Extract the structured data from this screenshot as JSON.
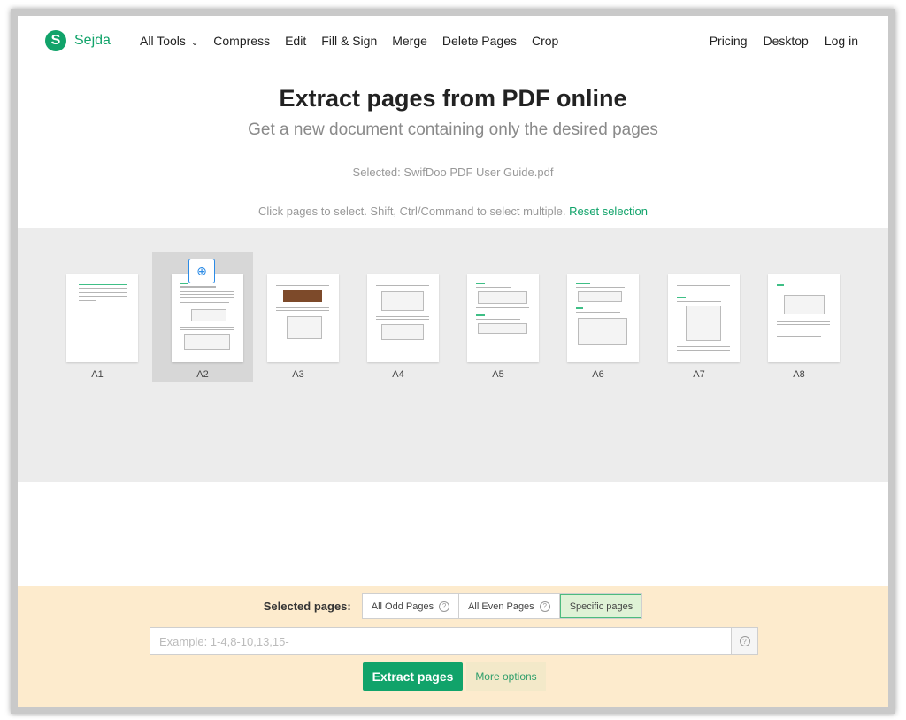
{
  "brand": {
    "name": "Sejda",
    "logo_letter": "S",
    "color": "#11a36a"
  },
  "nav": {
    "links": [
      "All Tools",
      "Compress",
      "Edit",
      "Fill & Sign",
      "Merge",
      "Delete Pages",
      "Crop"
    ],
    "right": [
      "Pricing",
      "Desktop",
      "Log in"
    ]
  },
  "header": {
    "title": "Extract pages from PDF online",
    "subtitle": "Get a new document containing only the desired pages",
    "selected_file": "Selected: SwifDoo PDF User Guide.pdf",
    "hint": "Click pages to select. Shift, Ctrl/Command to select multiple.",
    "reset_label": "Reset selection"
  },
  "pages": [
    {
      "label": "A1",
      "selected": false
    },
    {
      "label": "A2",
      "selected": true
    },
    {
      "label": "A3",
      "selected": false
    },
    {
      "label": "A4",
      "selected": false
    },
    {
      "label": "A5",
      "selected": false
    },
    {
      "label": "A6",
      "selected": false
    },
    {
      "label": "A7",
      "selected": false
    },
    {
      "label": "A8",
      "selected": false
    }
  ],
  "bottom": {
    "selected_pages_label": "Selected pages:",
    "options": [
      "All Odd Pages",
      "All Even Pages",
      "Specific pages"
    ],
    "active_option": "Specific pages",
    "range_placeholder": "Example: 1-4,8-10,13,15-",
    "range_value": "",
    "extract_label": "Extract pages",
    "more_label": "More options"
  }
}
